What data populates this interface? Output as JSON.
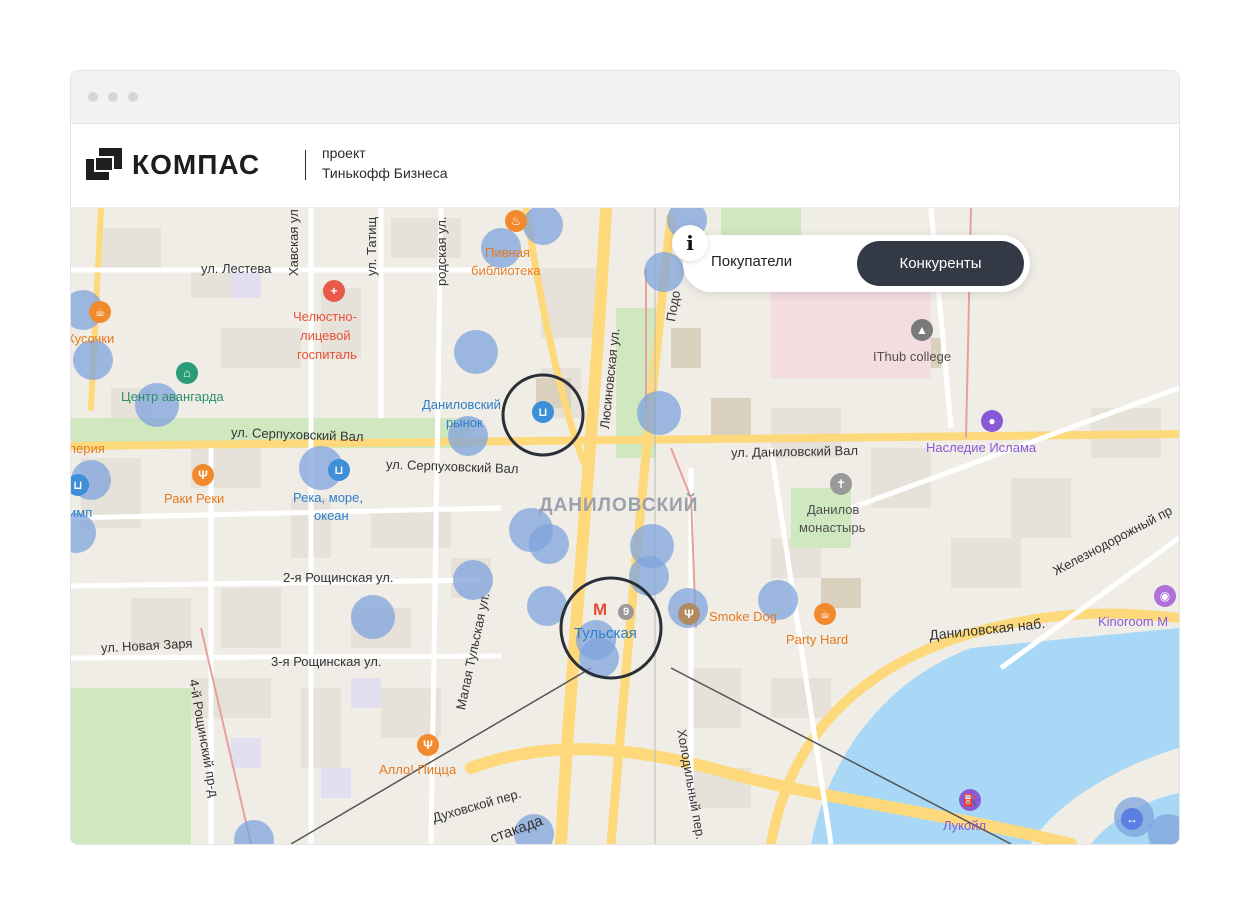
{
  "brand": {
    "name": "КОМПАС",
    "project_line1": "проект",
    "project_line2": "Тинькофф Бизнеса"
  },
  "map_toggle": {
    "info_glyph": "i",
    "buyers": "Покупатели",
    "competitors": "Конкуренты",
    "selected": "Конкуренты"
  },
  "streets": {
    "lesteva": "ул. Лестева",
    "khavskaya": "Хавская ул.",
    "tatishcheva": "ул. Татищ",
    "serpukhovskaya_left": "родская ул.",
    "serpukhovsky_val_1": "ул. Серпуховский Вал",
    "serpukhovsky_val_2": "ул. Серпуховский Вал",
    "danilovsky_val": "ул. Даниловский Вал",
    "lyusinovskaya": "Люсиновская ул.",
    "podolskoe": "Подо",
    "roshchinskaya_2": "2-я Рощинская ул.",
    "roshchinskaya_3": "3-я Рощинская ул.",
    "novaya_zarya": "ул. Новая Заря",
    "roshchinsky_4": "4-й Рощинский пр-д",
    "malaya_tulskaya": "Малая Тульская ул.",
    "dukhovskoy": "Духовской пер.",
    "estakada": "стакада",
    "kholodilny": "Холодильный пер.",
    "danilovskaya_nab": "Даниловская наб.",
    "railway": "Железнодорожный пр"
  },
  "district": "ДАНИЛОВСКИЙ",
  "pois": {
    "pivnaya_1": "Пивная",
    "pivnaya_2": "библиотека",
    "hospital_1": "Челюстно-",
    "hospital_2": "лицевой",
    "hospital_3": "госпиталь",
    "kusochki": "Кусочки",
    "center": "Центр авангарда",
    "market_1": "Даниловский",
    "market_2": "рынок",
    "periya": "перия",
    "raki": "Раки Реки",
    "reka_1": "Река, море,",
    "reka_2": "океан",
    "imp": "имп",
    "ithub": "IThub college",
    "nasledie": "Наследие Ислама",
    "monastery_1": "Данилов",
    "monastery_2": "монастырь",
    "smoke_dog": "Smoke Dog",
    "party_hard": "Party Hard",
    "kinoroom": "Kinoroom M",
    "allo": "Алло! Пицца",
    "lukoil": "Лукойл"
  },
  "metro": {
    "name": "Тульская",
    "line": "9",
    "symbol": "М"
  },
  "colors": {
    "accent": "#333a46",
    "heat_marker": "#7fa3dc",
    "highlight_ring": "#2a2f37",
    "road_major": "#fdd97c",
    "water": "#a8d8f5",
    "park": "#cfe8c0"
  },
  "icons": [
    "logo-icon",
    "info-icon",
    "shopping-basket-icon",
    "metro-icon",
    "restaurant-icon",
    "medical-cross-icon",
    "museum-icon",
    "church-icon",
    "education-icon",
    "fuel-icon",
    "cinema-icon",
    "cafe-icon",
    "beer-icon"
  ]
}
